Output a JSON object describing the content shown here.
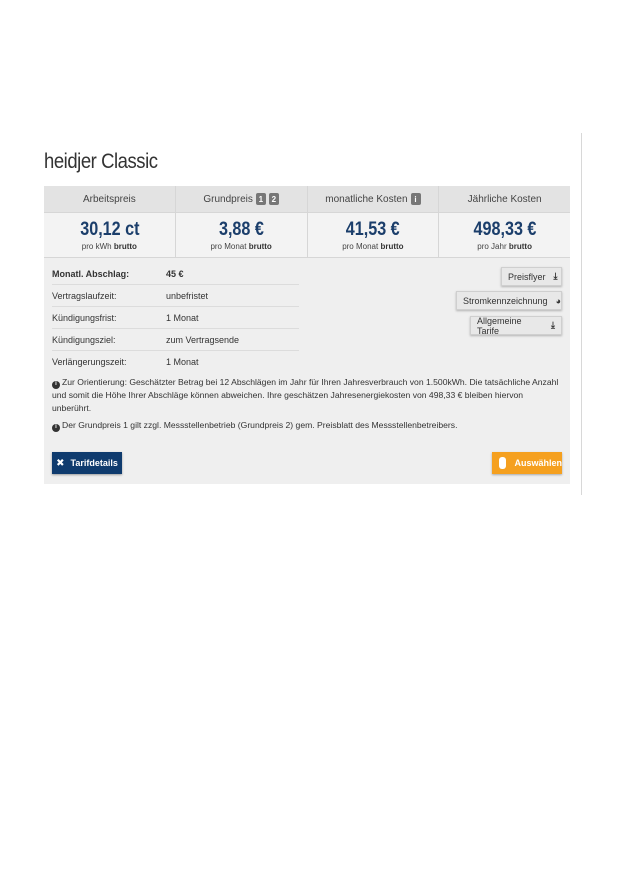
{
  "tariff": {
    "title": "heidjer Classic"
  },
  "columns": [
    {
      "label": "Arbeitspreis",
      "price": "30,12 ct",
      "unit": "pro kWh",
      "suffix": "brutto"
    },
    {
      "label": "Grundpreis",
      "price": "3,88 €",
      "unit": "pro Monat",
      "suffix": "brutto",
      "badges": [
        "1",
        "2"
      ]
    },
    {
      "label": "monatliche Kosten",
      "price": "41,53 €",
      "unit": "pro Monat",
      "suffix": "brutto",
      "badges": [
        "i"
      ]
    },
    {
      "label": "Jährliche Kosten",
      "price": "498,33 €",
      "unit": "pro Jahr",
      "suffix": "brutto"
    }
  ],
  "details": [
    {
      "label": "Monatl. Abschlag:",
      "value": "45 €"
    },
    {
      "label": "Vertragslaufzeit:",
      "value": "unbefristet"
    },
    {
      "label": "Kündigungsfrist:",
      "value": "1 Monat"
    },
    {
      "label": "Kündigungsziel:",
      "value": "zum Vertragsende"
    },
    {
      "label": "Verlängerungszeit:",
      "value": "1 Monat"
    }
  ],
  "side_buttons": {
    "flyer": {
      "label": "Preisflyer",
      "icon": "download-icon"
    },
    "label": {
      "label": "Stromkennzeichnung",
      "icon": "pie-chart-icon"
    },
    "terms": {
      "label": "Allgemeine Tarife",
      "icon": "download-icon"
    }
  },
  "notes": {
    "orientation": "Zur Orientierung: Geschätzter Betrag bei 12 Abschlägen im Jahr für Ihren Jahresverbrauch von 1.500kWh. Die tatsächliche Anzahl und somit die Höhe Ihrer Abschläge können abweichen. Ihre geschätzen Jahresenergiekosten von 498,33 € bleiben hiervon unberührt.",
    "base_price": "Der Grundpreis 1 gilt zzgl. Messstellenbetrieb (Grundpreis 2) gem. Preisblatt des Messstellenbetreibers."
  },
  "actions": {
    "details_label": "Tarifdetails",
    "select_label": "Auswählen"
  },
  "colors": {
    "primary": "#0f3b6e",
    "accent": "#f5a01f",
    "price": "#1b3e6b"
  }
}
